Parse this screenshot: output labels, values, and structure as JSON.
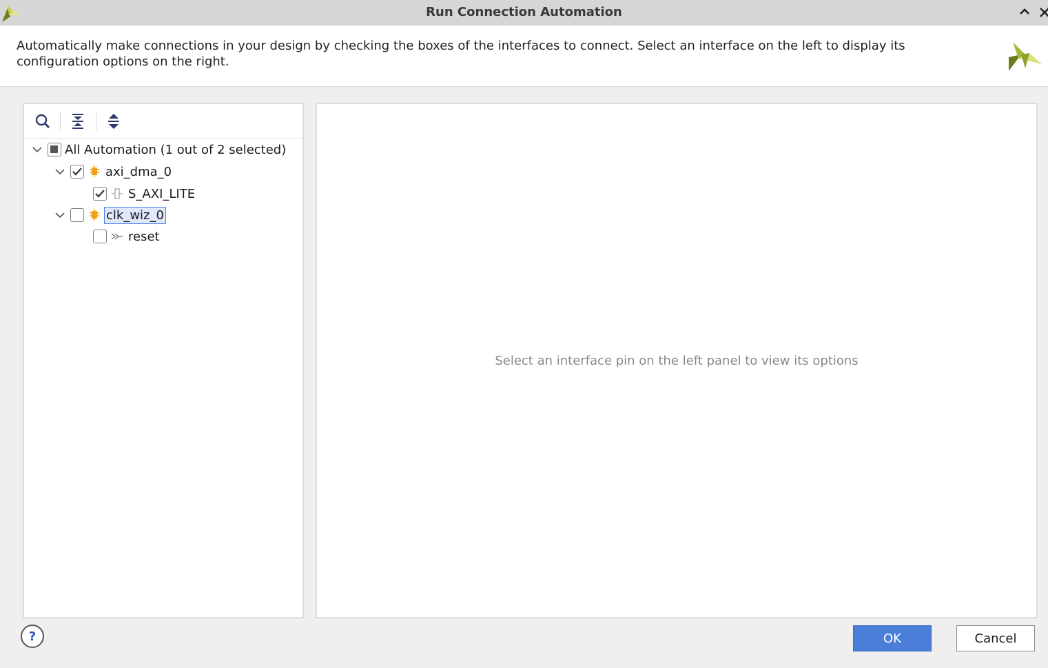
{
  "window": {
    "title": "Run Connection Automation"
  },
  "header": {
    "description": "Automatically make connections in your design by checking the boxes of the interfaces to connect. Select an interface on the left to display its configuration options on the right."
  },
  "toolbar": {
    "search_icon": "search-icon",
    "collapse_all_icon": "collapse-all-icon",
    "expand_all_icon": "expand-all-icon"
  },
  "tree": {
    "root": {
      "label": "All Automation (1 out of 2 selected)",
      "state": "partial"
    },
    "nodes": [
      {
        "label": "axi_dma_0",
        "checked": true,
        "expanded": true,
        "children": [
          {
            "label": "S_AXI_LITE",
            "checked": true,
            "icon": "interface-icon"
          }
        ]
      },
      {
        "label": "clk_wiz_0",
        "checked": false,
        "expanded": true,
        "selected": true,
        "children": [
          {
            "label": "reset",
            "checked": false,
            "icon": "reset-pin-icon"
          }
        ]
      }
    ]
  },
  "right_panel": {
    "hint": "Select an interface pin on the left panel to view its options"
  },
  "buttons": {
    "help": "?",
    "ok": "OK",
    "cancel": "Cancel"
  },
  "colors": {
    "accent": "#4a7ed8",
    "selection": "#dfe9fb",
    "ip_icon": "#f0a020"
  }
}
